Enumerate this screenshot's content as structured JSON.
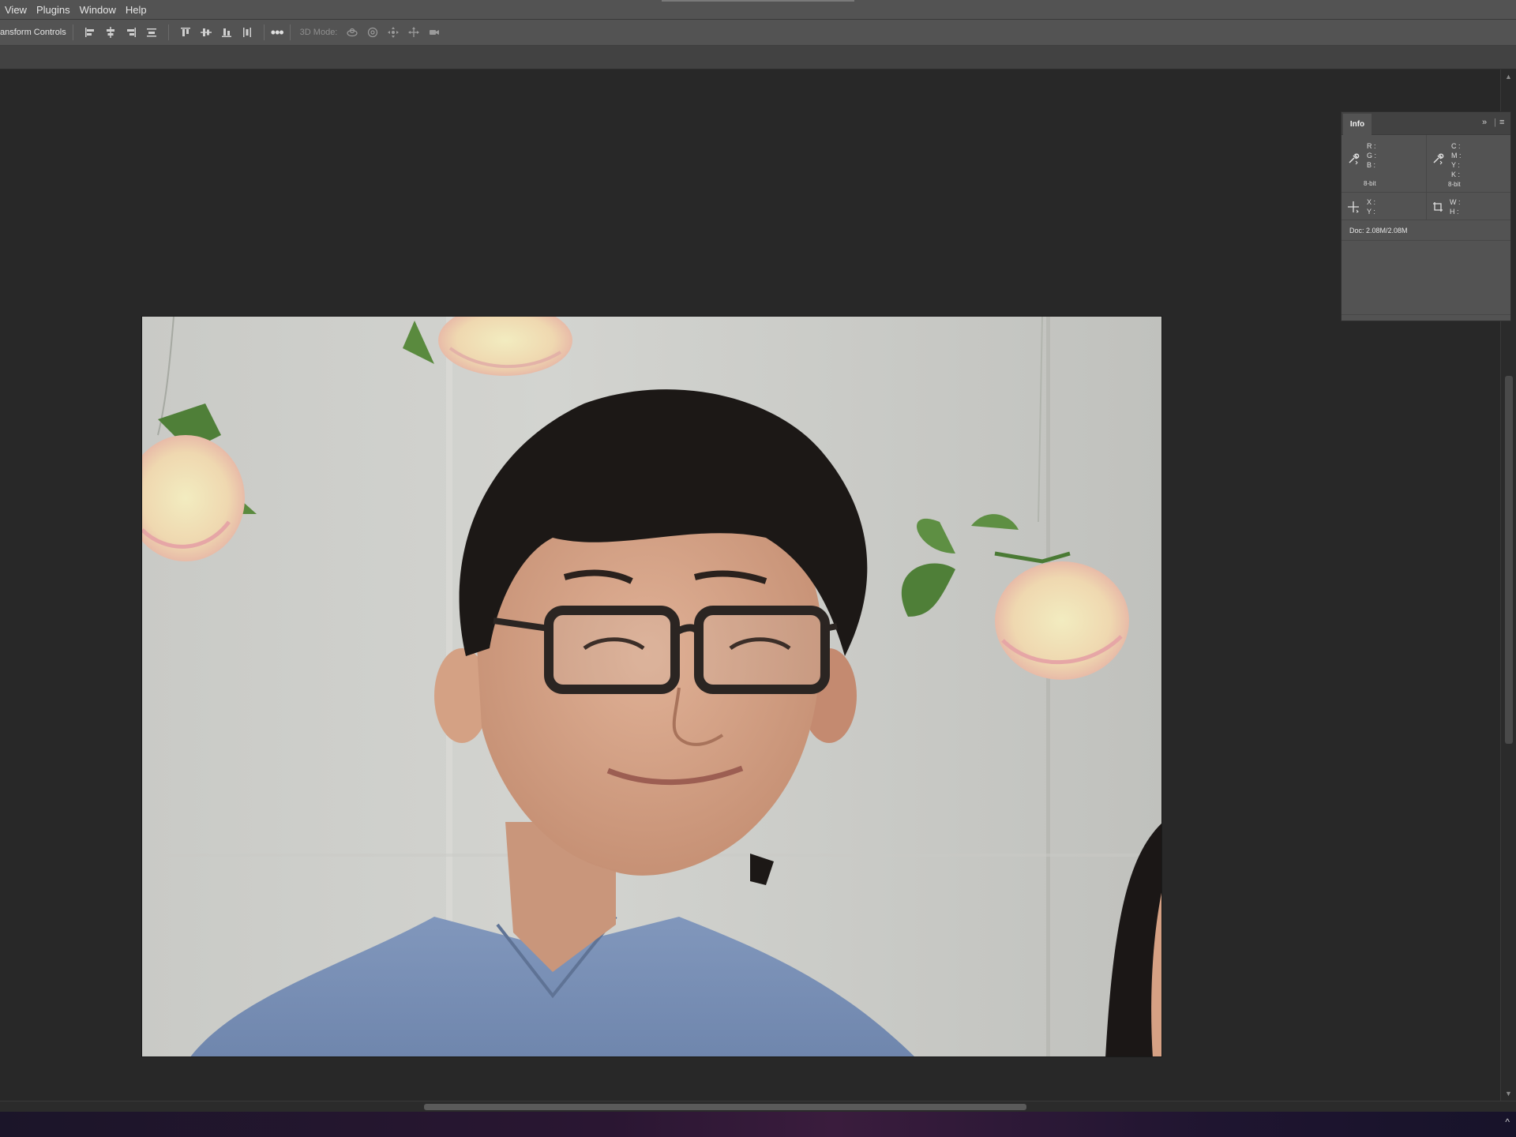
{
  "menubar": {
    "items": [
      "View",
      "Plugins",
      "Window",
      "Help"
    ]
  },
  "options_bar": {
    "transform_controls_label": "ansform Controls",
    "three_d_mode_label": "3D Mode:",
    "more_label": "•••"
  },
  "info_panel": {
    "tab_label": "Info",
    "rgb": {
      "r": "R :",
      "g": "G :",
      "b": "B :",
      "bits": "8-bit"
    },
    "cmyk": {
      "c": "C :",
      "m": "M :",
      "y": "Y :",
      "k": "K :",
      "bits": "8-bit"
    },
    "xy": {
      "x": "X :",
      "y": "Y :"
    },
    "wh": {
      "w": "W :",
      "h": "H :"
    },
    "doc": "Doc: 2.08M/2.08M"
  },
  "colors": {
    "menubar": "#535353",
    "workspace": "#282828",
    "panel": "#535353"
  }
}
